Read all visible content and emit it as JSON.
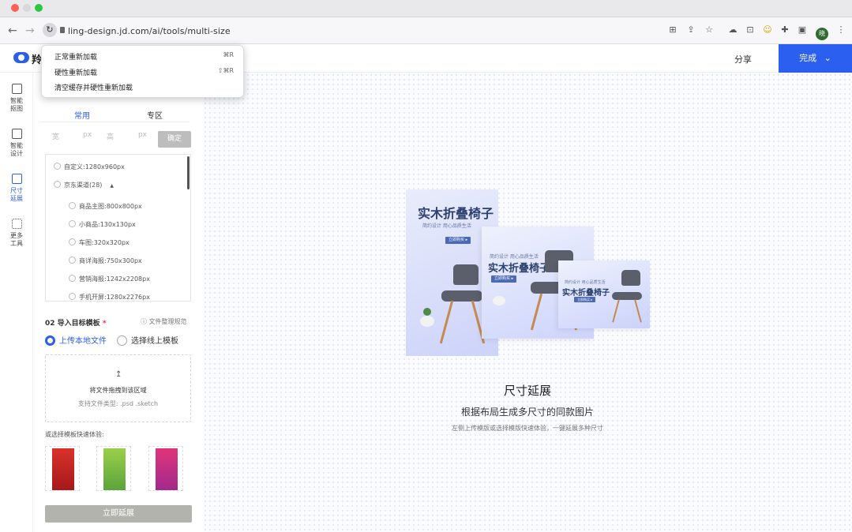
{
  "browser": {
    "url": "ling-design.jd.com/ai/tools/multi-size",
    "avatar_letter": "晓"
  },
  "reload_menu": {
    "items": [
      {
        "label": "正常重新加载",
        "shortcut": "⌘R"
      },
      {
        "label": "硬性重新加载",
        "shortcut": "⇧⌘R"
      },
      {
        "label": "清空缓存并硬性重新加载",
        "shortcut": ""
      }
    ]
  },
  "header": {
    "logo_text": "羚",
    "share_label": "分享",
    "done_label": "完成",
    "done_chevron": "⌄"
  },
  "rail": [
    {
      "label_line1": "智能",
      "label_line2": "抠图",
      "icon": "cutout-icon"
    },
    {
      "label_line1": "智能",
      "label_line2": "设计",
      "icon": "design-icon"
    },
    {
      "label_line1": "尺寸",
      "label_line2": "延展",
      "icon": "resize-icon",
      "active": true
    },
    {
      "label_line1": "更多",
      "label_line2": "工具",
      "icon": "more-tools-icon"
    }
  ],
  "panel": {
    "tabs": [
      "常用",
      "专区"
    ],
    "width_placeholder": "宽",
    "height_placeholder": "高",
    "unit": "px",
    "confirm_label": "确定",
    "sizes": [
      {
        "label": "自定义:1280x960px",
        "level": 0
      },
      {
        "label": "京东渠道(28)",
        "level": 0,
        "expand": "▲"
      },
      {
        "label": "商品主图:800x800px",
        "level": 1
      },
      {
        "label": "小商品:130x130px",
        "level": 1
      },
      {
        "label": "车图:320x320px",
        "level": 1
      },
      {
        "label": "商详海报:750x300px",
        "level": 1
      },
      {
        "label": "营销海报:1242x2208px",
        "level": 1
      },
      {
        "label": "手机开屏:1280x2276px",
        "level": 1
      }
    ],
    "section_title": "02 导入目标模板",
    "required_mark": "*",
    "file_spec_label": "文件整理规范",
    "upload_option": "上传本地文件",
    "online_option": "选择线上模板",
    "upload_icon": "↥",
    "upload_text": "将文件拖拽到该区域",
    "upload_types": "支持文件类型: .psd .sketch",
    "quick_label": "或选择模板快速体验:",
    "go_label": "立即延展"
  },
  "canvas": {
    "card_title": "实木折叠椅子",
    "card_subtitle": "简约设计 用心品质生活",
    "card_pill": "立即购买 ▸",
    "title": "尺寸延展",
    "subtitle": "根据布局生成多尺寸的同款图片",
    "hint": "左侧上传模版或选择模版快速体验，一键延展多种尺寸"
  },
  "colors": {
    "accent": "#2b5ff0",
    "disabled_button": "#b3b3ad"
  }
}
